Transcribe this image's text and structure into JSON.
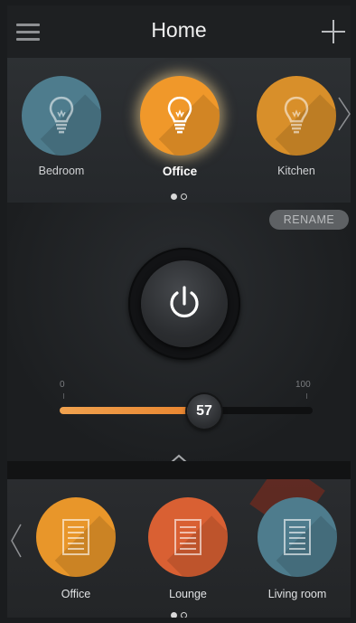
{
  "header": {
    "title": "Home"
  },
  "rooms": [
    {
      "label": "Bedroom",
      "color": "#4e7c8d",
      "active": false
    },
    {
      "label": "Office",
      "color": "#f0982a",
      "active": true
    },
    {
      "label": "Kitchen",
      "color": "#d88f2a",
      "active": false
    }
  ],
  "rooms_pager": {
    "current": 1,
    "total": 2
  },
  "control": {
    "rename_label": "RENAME",
    "slider": {
      "min": "0",
      "max": "100",
      "value": "57",
      "fraction": 0.57
    }
  },
  "devices": [
    {
      "label": "Office",
      "color": "#e8962a"
    },
    {
      "label": "Lounge",
      "color": "#d96033"
    },
    {
      "label": "Living room",
      "color": "#4e7c8d"
    }
  ],
  "devices_pager": {
    "current": 1,
    "total": 2
  },
  "colors": {
    "accent": "#f0982a",
    "slider_fill": "#e8832d"
  },
  "icons": [
    "menu-icon",
    "plus-icon",
    "bulb-icon",
    "chevron-right-icon",
    "power-icon",
    "double-chevron-up-icon",
    "chevron-left-icon",
    "document-icon"
  ]
}
